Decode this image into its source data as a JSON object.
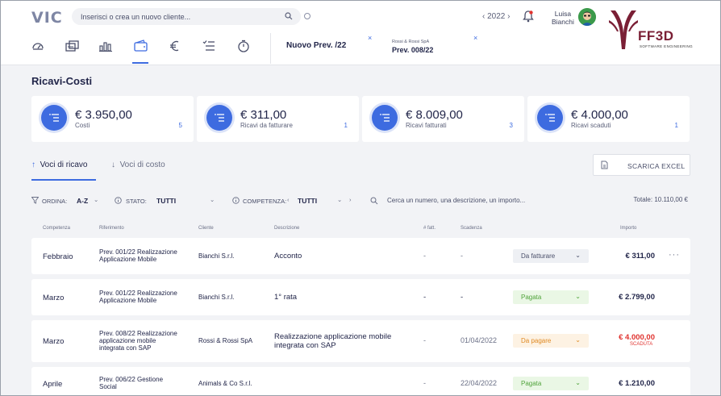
{
  "header": {
    "logo": "VIC",
    "search_placeholder": "Inserisci o crea un nuovo cliente...",
    "year": "‹ 2022 ›",
    "user_first": "Luisa",
    "user_last": "Bianchi",
    "brand_name": "FF3D",
    "brand_sub": "SOFTWARE ENGINEERING"
  },
  "nav": {
    "icons": [
      "dashboard-icon",
      "documents-icon",
      "chart-icon",
      "wallet-icon",
      "euro-icon",
      "checklist-icon",
      "timer-icon"
    ],
    "tab1": "Nuovo Prev. /22",
    "tab2_sub": "Rossi & Rossi SpA",
    "tab2": "Prev. 008/22",
    "close": "×"
  },
  "page": {
    "title": "Ricavi-Costi"
  },
  "cards": [
    {
      "amount": "€ 3.950,00",
      "label": "Costi",
      "count": "5"
    },
    {
      "amount": "€ 311,00",
      "label": "Ricavi da fatturare",
      "count": "1"
    },
    {
      "amount": "€ 8.009,00",
      "label": "Ricavi fatturati",
      "count": "3"
    },
    {
      "amount": "€ 4.000,00",
      "label": "Ricavi scaduti",
      "count": "1"
    }
  ],
  "tabs": {
    "ricavo": "Voci di ricavo",
    "costo": "Voci di costo",
    "excel": "SCARICA EXCEL"
  },
  "filters": {
    "ordina_label": "ORDINA:",
    "ordina_value": "A-Z",
    "stato_label": "STATO:",
    "stato_value": "TUTTI",
    "competenza_label": "COMPETENZA:",
    "competenza_value": "TUTTI",
    "search_placeholder": "Cerca un numero, una descrizione, un importo...",
    "total": "Totale: 10.110,00 €"
  },
  "table": {
    "headers": {
      "competenza": "Competenza",
      "riferimento": "Riferimento",
      "cliente": "Cliente",
      "descrizione": "Descrizione",
      "nfatt": "# fatt.",
      "scadenza": "Scadenza",
      "importo": "Importo"
    },
    "rows": [
      {
        "competenza": "Febbraio",
        "rif1": "Prev. 001/22 Realizzazione",
        "rif2": "Applicazione Mobile",
        "rif3": "",
        "cliente": "Bianchi S.r.l.",
        "desc1": "Acconto",
        "desc2": "",
        "nfatt": "-",
        "scadenza": "-",
        "stato": "Da fatturare",
        "importo": "€ 311,00",
        "note": "",
        "more": "···"
      },
      {
        "competenza": "Marzo",
        "rif1": "Prev. 001/22 Realizzazione",
        "rif2": "Applicazione Mobile",
        "rif3": "",
        "cliente": "Bianchi S.r.l.",
        "desc1": "1° rata",
        "desc2": "",
        "nfatt": "-",
        "scadenza": "-",
        "stato": "Pagata",
        "importo": "€ 2.799,00",
        "note": "",
        "more": ""
      },
      {
        "competenza": "Marzo",
        "rif1": "Prev. 008/22 Realizzazione",
        "rif2": "applicazione mobile",
        "rif3": "integrata con SAP",
        "cliente": "Rossi & Rossi SpA",
        "desc1": "Realizzazione applicazione mobile",
        "desc2": "integrata con SAP",
        "nfatt": "-",
        "scadenza": "01/04/2022",
        "stato": "Da pagare",
        "importo": "€ 4.000,00",
        "note": "SCADUTA",
        "more": ""
      },
      {
        "competenza": "Aprile",
        "rif1": "Prev. 006/22 Gestione",
        "rif2": "Social",
        "rif3": "",
        "cliente": "Animals & Co S.r.l.",
        "desc1": "",
        "desc2": "",
        "nfatt": "-",
        "scadenza": "22/04/2022",
        "stato": "Pagata",
        "importo": "€ 1.210,00",
        "note": "",
        "more": ""
      }
    ]
  },
  "colors": {
    "accent": "#3d6be0",
    "brand": "#7a1f35",
    "paid": "#4fa33a",
    "due": "#e08a24",
    "overdue": "#e0332f"
  }
}
